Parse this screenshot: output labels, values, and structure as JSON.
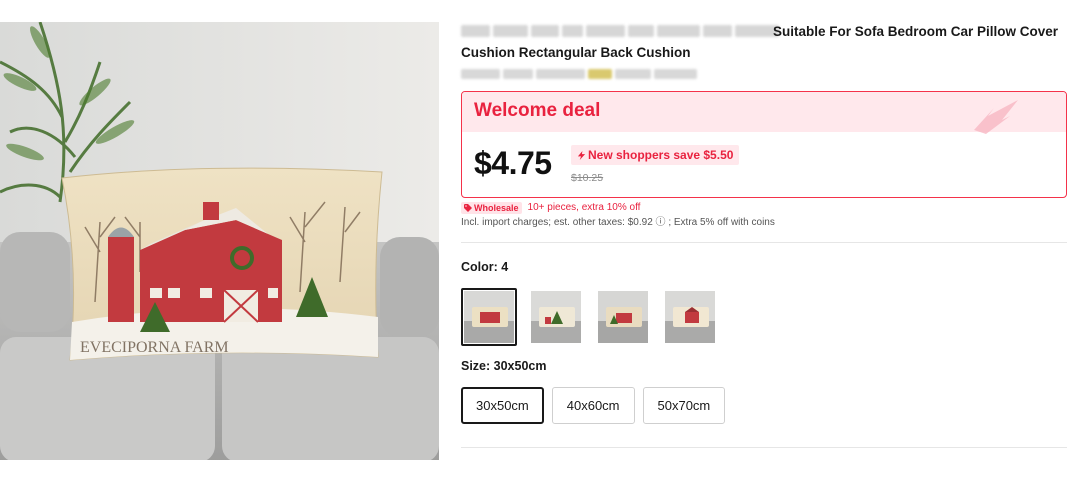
{
  "product": {
    "title_visible_tail": "Suitable For Sofa Bedroom Car Pillow Cover",
    "title_line_2": "Cushion Rectangular Back Cushion",
    "image_text": "EVECIPORNA  FARM"
  },
  "deal": {
    "title": "Welcome deal",
    "price": "$4.75",
    "save_badge": "New shoppers save $5.50",
    "original_price": "$10.25"
  },
  "wholesale": {
    "tag": "Wholesale",
    "text": "10+ pieces, extra 10% off"
  },
  "tax_line": "Incl. import charges; est. other taxes: $0.92 ⓘ ; Extra 5% off with coins",
  "color": {
    "label": "Color: 4",
    "options": [
      "color-1",
      "color-2",
      "color-3",
      "color-4"
    ],
    "selected_index": 0
  },
  "size": {
    "label": "Size: 30x50cm",
    "options": [
      "30x50cm",
      "40x60cm",
      "50x70cm"
    ],
    "selected": "30x50cm"
  },
  "colors": {
    "accent_red": "#e9223f",
    "deal_head_bg": "#ffe8ec",
    "barn_red": "#c23a3f"
  },
  "icons": {
    "badge_icon": "flame-icon",
    "wholesale_icon": "tag-icon",
    "info_icon": "info-icon"
  }
}
